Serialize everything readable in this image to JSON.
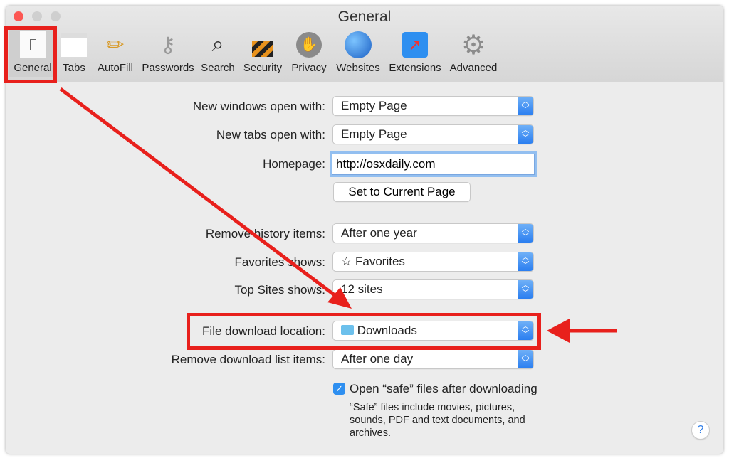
{
  "window": {
    "title": "General"
  },
  "toolbar": [
    {
      "label": "General",
      "icon": "switch-icon"
    },
    {
      "label": "Tabs",
      "icon": "tabs-icon"
    },
    {
      "label": "AutoFill",
      "icon": "pencil-icon"
    },
    {
      "label": "Passwords",
      "icon": "key-icon"
    },
    {
      "label": "Search",
      "icon": "magnifier-icon"
    },
    {
      "label": "Security",
      "icon": "lock-icon"
    },
    {
      "label": "Privacy",
      "icon": "hand-icon"
    },
    {
      "label": "Websites",
      "icon": "globe-icon"
    },
    {
      "label": "Extensions",
      "icon": "puzzle-compass-icon"
    },
    {
      "label": "Advanced",
      "icon": "gear-icon"
    }
  ],
  "form": {
    "new_windows": {
      "label": "New windows open with:",
      "value": "Empty Page"
    },
    "new_tabs": {
      "label": "New tabs open with:",
      "value": "Empty Page"
    },
    "homepage": {
      "label": "Homepage:",
      "value": "http://osxdaily.com"
    },
    "set_current": "Set to Current Page",
    "remove_history": {
      "label": "Remove history items:",
      "value": "After one year"
    },
    "favorites": {
      "label": "Favorites shows:",
      "value": "Favorites",
      "icon": "star-icon"
    },
    "top_sites": {
      "label": "Top Sites shows:",
      "value": "12 sites"
    },
    "download_location": {
      "label": "File download location:",
      "value": "Downloads",
      "icon": "folder-icon"
    },
    "remove_downloads": {
      "label": "Remove download list items:",
      "value": "After one day"
    },
    "open_safe": {
      "label": "Open “safe” files after downloading",
      "checked": true,
      "note": "“Safe” files include movies, pictures, sounds, PDF and text documents, and archives."
    },
    "help": "?"
  },
  "annotation_color": "#e8201c"
}
